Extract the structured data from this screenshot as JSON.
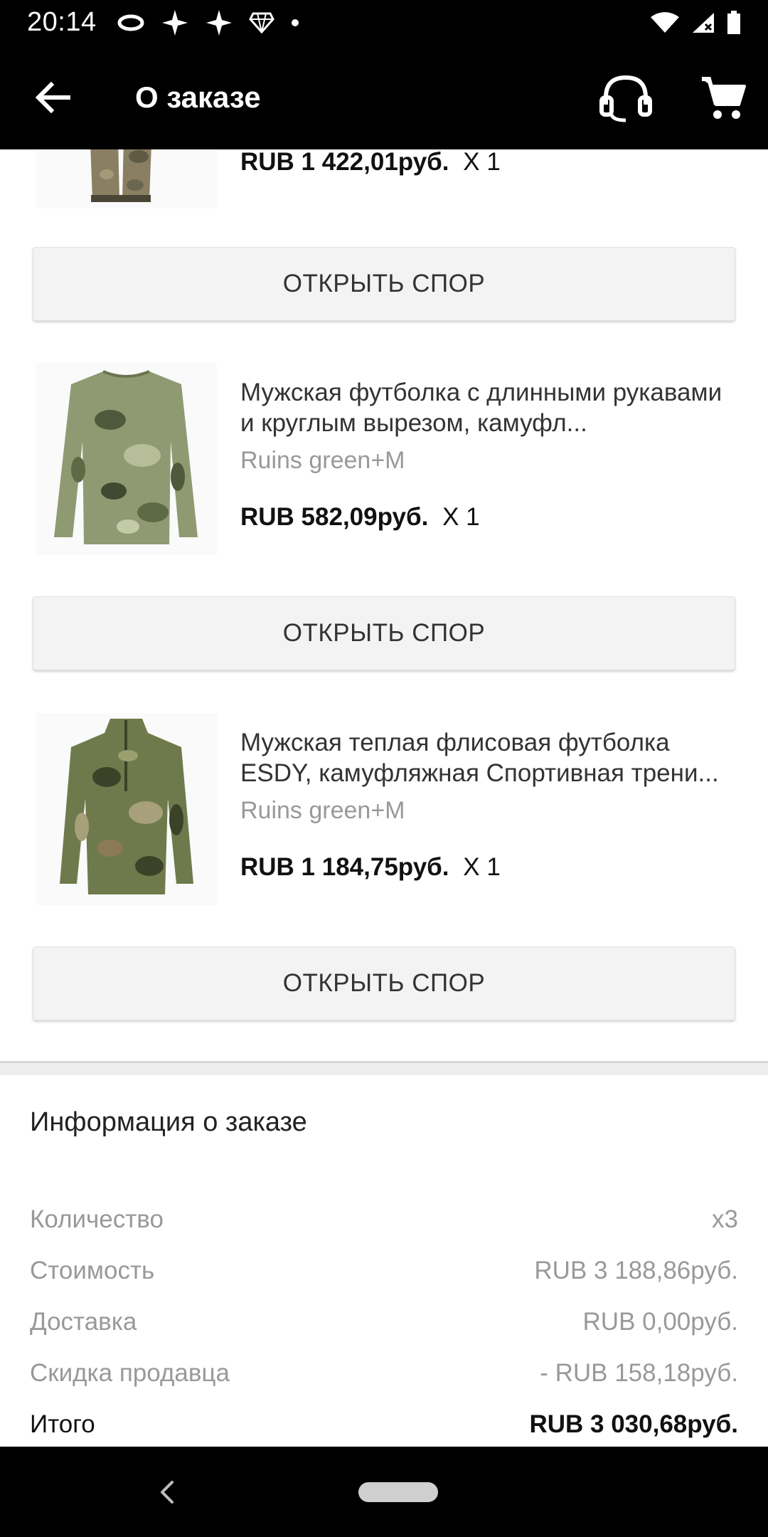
{
  "status_bar": {
    "time": "20:14"
  },
  "app_bar": {
    "title": "О заказе"
  },
  "products": [
    {
      "title": "",
      "variant": "",
      "price": "RUB 1 422,01руб.",
      "qty": "X 1",
      "dispute_label": "ОТКРЫТЬ СПОР"
    },
    {
      "title": "Мужская футболка с длинными рукавами и круглым вырезом, камуфл...",
      "variant": "Ruins green+M",
      "price": "RUB 582,09руб.",
      "qty": "X 1",
      "dispute_label": "ОТКРЫТЬ СПОР"
    },
    {
      "title": "Мужская теплая флисовая футболка ESDY, камуфляжная Спортивная трени...",
      "variant": "Ruins green+M",
      "price": "RUB 1 184,75руб.",
      "qty": "X 1",
      "dispute_label": "ОТКРЫТЬ СПОР"
    }
  ],
  "order_info": {
    "title": "Информация о заказе",
    "rows": [
      {
        "label": "Количество",
        "value": "x3"
      },
      {
        "label": "Стоимость",
        "value": "RUB 3 188,86руб."
      },
      {
        "label": "Доставка",
        "value": "RUB 0,00руб."
      },
      {
        "label": "Скидка продавца",
        "value": "- RUB 158,18руб."
      },
      {
        "label": "Итого",
        "value": "RUB 3 030,68руб."
      }
    ]
  },
  "colors": {
    "app_bar_bg": "#000000",
    "button_bg": "#f3f3f3",
    "muted_text": "#999999",
    "camo_green": "#7d8a5e"
  },
  "icons": [
    "back-arrow-icon",
    "headset-icon",
    "cart-icon",
    "nav-back-icon"
  ]
}
